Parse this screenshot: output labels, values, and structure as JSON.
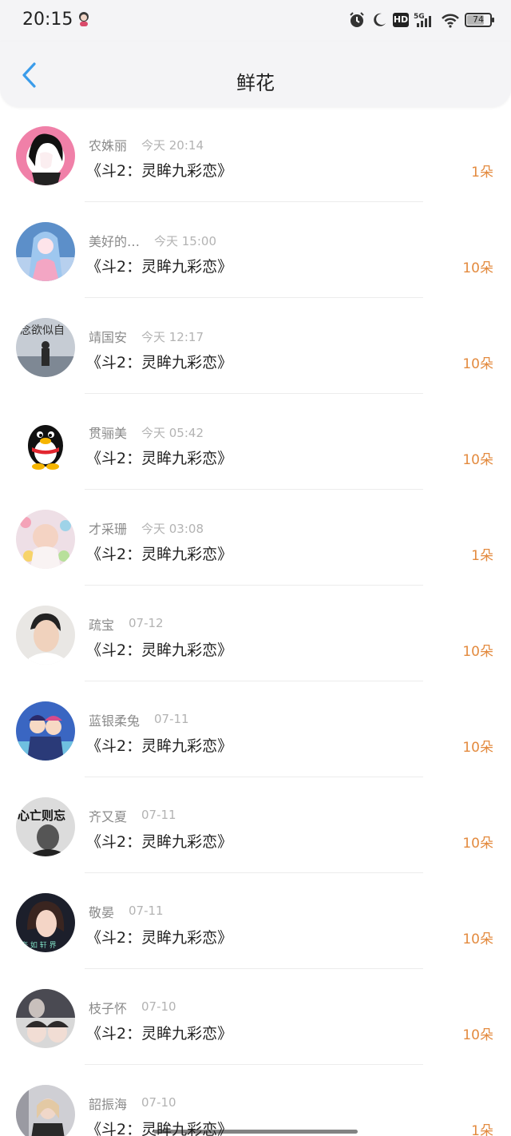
{
  "status_bar": {
    "time": "20:15",
    "network": "5G",
    "hd_label": "HD",
    "battery": "74",
    "icons": [
      "alarm-icon",
      "moon-icon",
      "hd-icon",
      "5g-signal-icon",
      "wifi-icon",
      "battery-icon"
    ]
  },
  "nav": {
    "title": "鲜花",
    "back_icon": "chevron-left-icon"
  },
  "colors": {
    "accent_back": "#3a9cea",
    "count": "#e38a3e",
    "name": "#8a8a8a",
    "time": "#b3b3b3",
    "header_bg": "#f4f4f6"
  },
  "gifts": [
    {
      "name": "农姝丽",
      "time": "今天 20:14",
      "book": "《斗2：灵眸九彩恋》",
      "count": "1朵",
      "avatar": "anime-illustration"
    },
    {
      "name": "美好的…",
      "time": "今天 15:00",
      "book": "《斗2：灵眸九彩恋》",
      "count": "10朵",
      "avatar": "anime-girl"
    },
    {
      "name": "靖国安",
      "time": "今天 12:17",
      "book": "《斗2：灵眸九彩恋》",
      "count": "10朵",
      "avatar": "landscape-text"
    },
    {
      "name": "贯骊美",
      "time": "今天 05:42",
      "book": "《斗2：灵眸九彩恋》",
      "count": "10朵",
      "avatar": "penguin"
    },
    {
      "name": "才采珊",
      "time": "今天 03:08",
      "book": "《斗2：灵眸九彩恋》",
      "count": "1朵",
      "avatar": "baby"
    },
    {
      "name": "疏宝",
      "time": "07-12",
      "book": "《斗2：灵眸九彩恋》",
      "count": "10朵",
      "avatar": "man-portrait"
    },
    {
      "name": "蓝银柔兔",
      "time": "07-11",
      "book": "《斗2：灵眸九彩恋》",
      "count": "10朵",
      "avatar": "anime-couple"
    },
    {
      "name": "齐又夏",
      "time": "07-11",
      "book": "《斗2：灵眸九彩恋》",
      "count": "10朵",
      "avatar": "bw-text"
    },
    {
      "name": "敬晏",
      "time": "07-11",
      "book": "《斗2：灵眸九彩恋》",
      "count": "10朵",
      "avatar": "woman-portrait"
    },
    {
      "name": "枝子怀",
      "time": "07-10",
      "book": "《斗2：灵眸九彩恋》",
      "count": "10朵",
      "avatar": "collage"
    },
    {
      "name": "韶振海",
      "time": "07-10",
      "book": "《斗2：灵眸九彩恋》",
      "count": "1朵",
      "avatar": "woman-street"
    }
  ]
}
